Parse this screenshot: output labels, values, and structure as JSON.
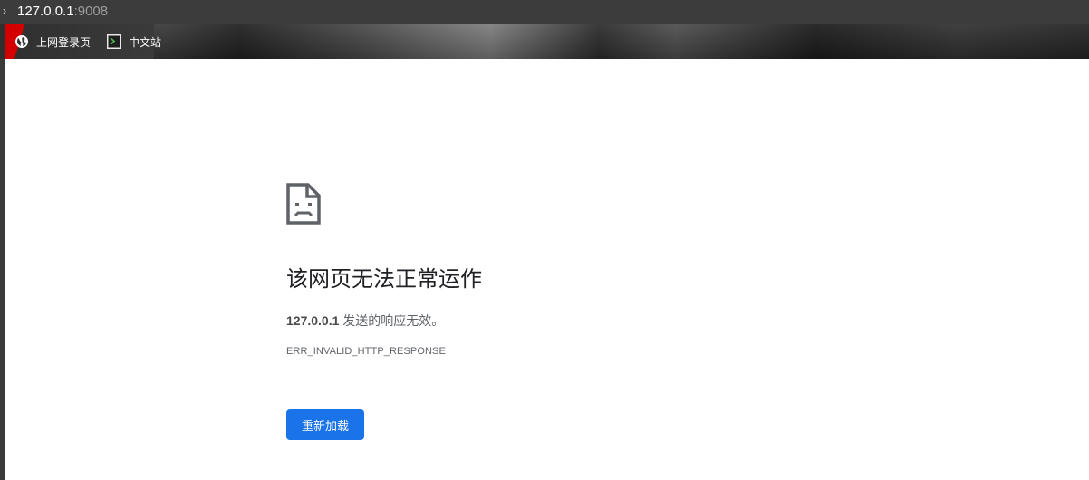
{
  "address_bar": {
    "host": "127.0.0.1",
    "port_suffix": ":9008",
    "chevron": "›"
  },
  "bookmarks": [
    {
      "label": "上网登录页",
      "icon": "globe-icon"
    },
    {
      "label": "中文站",
      "icon": "terminal-icon"
    }
  ],
  "error_page": {
    "icon": "sad-file-icon",
    "title": "该网页无法正常运作",
    "host": "127.0.0.1",
    "description_suffix": " 发送的响应无效。",
    "error_code": "ERR_INVALID_HTTP_RESPONSE",
    "reload_label": "重新加载"
  },
  "colors": {
    "accent": "#1a73e8",
    "title_text": "#202124",
    "body_text": "#5f6368",
    "bookmark_flag": "#d40000"
  }
}
